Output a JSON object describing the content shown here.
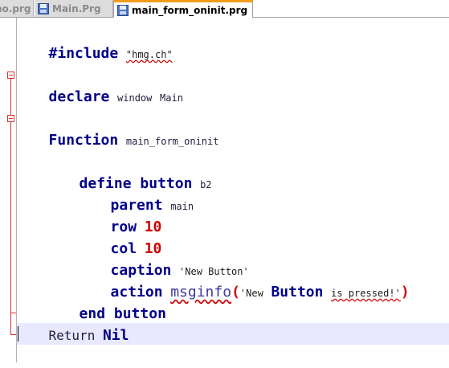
{
  "tabs": [
    {
      "label": "no.prg",
      "active": false,
      "saved_icon": "floppy-disk-icon"
    },
    {
      "label": "Main.Prg",
      "active": false,
      "saved_icon": "floppy-disk-icon"
    },
    {
      "label": "main_form_oninit.prg",
      "active": true,
      "saved_icon": "floppy-disk-icon"
    }
  ],
  "code": {
    "line1": {
      "kw": "#include",
      "str": "\"hmg.ch\""
    },
    "line2": {
      "kw": "declare",
      "id1": "window",
      "id2": "Main"
    },
    "line3": {
      "kw": "Function",
      "id": "main_form_oninit"
    },
    "line4": {
      "kw": "define button",
      "id": "b2"
    },
    "line5": {
      "kw": "parent",
      "id": "main"
    },
    "line6": {
      "kw": "row",
      "num": "10"
    },
    "line7": {
      "kw": "col",
      "num": "10"
    },
    "line8": {
      "kw": "caption",
      "str": "'New Button'"
    },
    "line9": {
      "kw": "action",
      "fn": "msginfo",
      "open": "(",
      "str1": "'New",
      "kw2": "Button",
      "str2": "is pressed!'",
      "close": ")"
    },
    "line10": {
      "kw": "end button"
    },
    "line11": {
      "kw": "Return",
      "kw2": "Nil"
    }
  },
  "colors": {
    "keyword": "#00008b",
    "number": "#d00000",
    "fold_marker": "#e23030",
    "active_tab_accent": "#f39c1c",
    "current_line": "#e8e8ff"
  }
}
